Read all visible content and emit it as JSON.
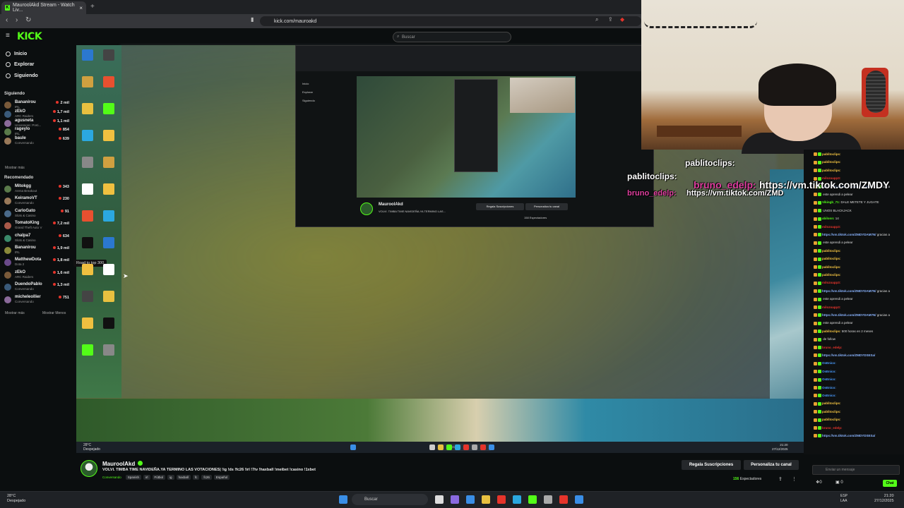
{
  "browser": {
    "tab_title": "MauroolAkd Stream - Watch Liv...",
    "url": "kick.com/mauroakd",
    "new_tab": "+"
  },
  "kick": {
    "logo": "KICK",
    "search_placeholder": "Buscar",
    "nav": [
      "Inicio",
      "Explorar",
      "Siguiendo"
    ],
    "following_title": "Siguiendo",
    "following": [
      {
        "name": "Bananirou",
        "sub": "IRL",
        "viewers": "2 mil"
      },
      {
        "name": "zEkO",
        "sub": "ARC Raiders",
        "viewers": "1,7 mil"
      },
      {
        "name": "agusneta",
        "sub": "Uncensore: Preti...",
        "viewers": "1,1 mil"
      },
      {
        "name": "rageylo",
        "sub": "IRL",
        "viewers": "854"
      },
      {
        "name": "baule",
        "sub": "Conversando",
        "viewers": "639"
      }
    ],
    "show_more": "Mostrar más",
    "recommended_title": "Recomendado",
    "recommended": [
      {
        "name": "Mitokgg",
        "sub": "Arena Breakout",
        "viewers": "343"
      },
      {
        "name": "KeiramoVT",
        "sub": "Conversando",
        "viewers": "230"
      },
      {
        "name": "CarloGato",
        "sub": "Slots & Casino",
        "viewers": "91"
      },
      {
        "name": "TomatoKing",
        "sub": "Grand Theft Auto V",
        "viewers": "7,2 mil"
      },
      {
        "name": "chalpa7",
        "sub": "Slots & Casino",
        "viewers": "634"
      },
      {
        "name": "Bananirou",
        "sub": "IRL",
        "viewers": "1,9 mil"
      },
      {
        "name": "MatthewDota",
        "sub": "Dota 2",
        "viewers": "1,8 mil"
      },
      {
        "name": "zEkO",
        "sub": "ARC Raiders",
        "viewers": "1,6 mil"
      },
      {
        "name": "DuendoPablo",
        "sub": "Conversando",
        "viewers": "1,3 mil"
      },
      {
        "name": "micheleollier",
        "sub": "Conversando",
        "viewers": "751"
      }
    ],
    "show_more_2": "Mostrar más",
    "show_less": "Mostrar Menos",
    "tooltip": "Road to top 300"
  },
  "embed": {
    "nav": [
      "Inicio",
      "Explorar",
      "Siguiendo"
    ],
    "streamer": "MauroolAkd",
    "title": "VOLVI. TIMBA TIME NAVIDEÑA.YA TERMINO LAS...",
    "btn_subs": "Regala Suscripciones",
    "btn_custom": "Personaliza tu canal",
    "viewers": "158 Espectadores"
  },
  "inner_taskbar": {
    "weather_temp": "28°C",
    "weather_desc": "Despejado",
    "search": "Buscar",
    "time": "21:20",
    "date": "27/12/2025"
  },
  "overlay": {
    "line1": "pablitoclips:",
    "line2_user": "bruno_edelp:",
    "line2_link": "https://vm.tiktok.com/ZMDY",
    "line3_user": "pablitoclips:",
    "line4_user": "bruno_edelp:",
    "line4_link": "https://vm.tiktok.com/ZMD"
  },
  "chat": [
    {
      "user": "pablitoclips:",
      "text": "",
      "color": "#f5c542"
    },
    {
      "user": "pablitoclips:",
      "text": "",
      "color": "#f5c542"
    },
    {
      "user": "pablitoclips:",
      "text": "",
      "color": "#f5c542"
    },
    {
      "user": "milozoapp3:",
      "text": "",
      "color": "#e5342b"
    },
    {
      "user": "https://vm.tiktok.com/ZMDYDAM7N/",
      "text": "gracias a",
      "color": "#8ab4ff"
    },
    {
      "user": "",
      "text": "este aprendi a pelear",
      "color": "#ddd"
    },
    {
      "user": "Vikingb_71:",
      "text": "DALE METETE Y JUGATE",
      "color": "#53fc18"
    },
    {
      "user": "",
      "text": "UNOS BLACKJACK",
      "color": "#ddd"
    },
    {
      "user": "abilonn:",
      "text": "14",
      "color": "#53fc18"
    },
    {
      "user": "milozoapp3:",
      "text": "",
      "color": "#e5342b"
    },
    {
      "user": "https://vm.tiktok.com/ZMDYDAM7N/",
      "text": "gracias a",
      "color": "#8ab4ff"
    },
    {
      "user": "",
      "text": "este aprendi a pelear",
      "color": "#ddd"
    },
    {
      "user": "pablitoclips:",
      "text": "",
      "color": "#f5c542"
    },
    {
      "user": "pablitoclips:",
      "text": "",
      "color": "#f5c542"
    },
    {
      "user": "pablitoclips:",
      "text": "",
      "color": "#f5c542"
    },
    {
      "user": "pablitoclips:",
      "text": "",
      "color": "#f5c542"
    },
    {
      "user": "milozoapp3:",
      "text": "",
      "color": "#e5342b"
    },
    {
      "user": "https://vm.tiktok.com/ZMDYDAM7N/",
      "text": "gracias a",
      "color": "#8ab4ff"
    },
    {
      "user": "",
      "text": "este aprendi a pelear",
      "color": "#ddd"
    },
    {
      "user": "milozoapp3:",
      "text": "",
      "color": "#e5342b"
    },
    {
      "user": "https://vm.tiktok.com/ZMDYDAM7N/",
      "text": "gracias a",
      "color": "#8ab4ff"
    },
    {
      "user": "",
      "text": "este aprendi a pelear",
      "color": "#ddd"
    },
    {
      "user": "pablitoclips:",
      "text": "500 horas en 2 meses",
      "color": "#f5c542"
    },
    {
      "user": "",
      "text": "de follow",
      "color": "#ddd"
    },
    {
      "user": "bruno_edelp:",
      "text": "",
      "color": "#e5342b"
    },
    {
      "user": "https://vm.tiktok.com/ZMDYDSESa/",
      "text": "",
      "color": "#8ab4ff"
    },
    {
      "user": "OsEnico:",
      "text": "",
      "color": "#4a9cff"
    },
    {
      "user": "OsEnico:",
      "text": "",
      "color": "#4a9cff"
    },
    {
      "user": "OsEnico:",
      "text": "",
      "color": "#4a9cff"
    },
    {
      "user": "OsEnico:",
      "text": "",
      "color": "#4a9cff"
    },
    {
      "user": "OsEnico:",
      "text": "",
      "color": "#4a9cff"
    },
    {
      "user": "pablitoclips:",
      "text": "",
      "color": "#f5c542"
    },
    {
      "user": "pablitoclips:",
      "text": "",
      "color": "#f5c542"
    },
    {
      "user": "pablitoclips:",
      "text": "",
      "color": "#f5c542"
    },
    {
      "user": "bruno_edelp:",
      "text": "",
      "color": "#e5342b"
    },
    {
      "user": "https://vm.tiktok.com/ZMDYDSESa/",
      "text": "",
      "color": "#8ab4ff"
    }
  ],
  "chat_input": {
    "placeholder": "Enviar un mensaje",
    "send": "Chat",
    "count": "0"
  },
  "stream": {
    "streamer": "MauroolAkd",
    "title": "VOLVI. TIMBA TIME NAVIDEÑA.YA TERMINO LAS VOTACIONES| !ig !ds !fc26 !irl !7tv !haxball !meibet !casino !1xbet",
    "category": "Conversando",
    "tags": [
      "Spanish",
      "irl",
      "Fútbol",
      "ig",
      "haxball",
      "fc",
      "fc26",
      "Español"
    ],
    "btn_subs": "Regala Suscripciones",
    "btn_custom": "Personaliza tu canal",
    "viewers_num": "156",
    "viewers_label": "Espectadores"
  },
  "taskbar": {
    "weather_temp": "28°C",
    "weather_desc": "Despejado",
    "search": "Buscar",
    "lang": "ESP",
    "lang2": "LAA",
    "time": "21:20",
    "date": "27/12/2025"
  },
  "colors": {
    "accent": "#53fc18",
    "live": "#e5342b"
  }
}
